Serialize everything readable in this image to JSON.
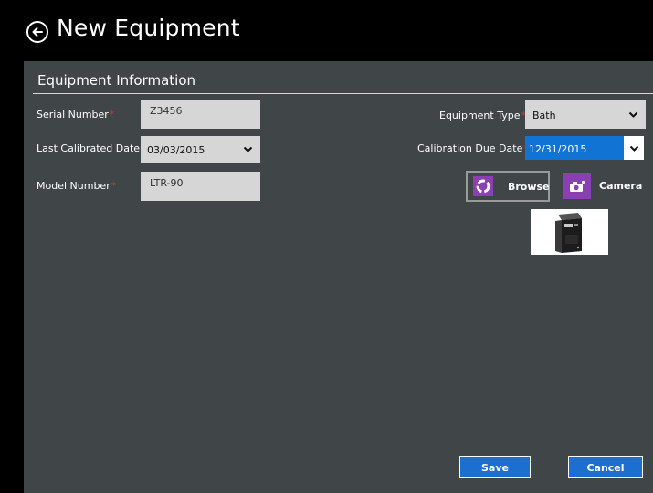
{
  "header": {
    "title": "New Equipment",
    "back_icon": "back-arrow-icon"
  },
  "section": {
    "title": "Equipment Information"
  },
  "fields": {
    "serial_number": {
      "label": "Serial Number",
      "required_mark": "*",
      "value": "Z3456"
    },
    "last_calibrated_date": {
      "label": "Last Calibrated Date",
      "required_mark": "*",
      "value": "03/03/2015"
    },
    "model_number": {
      "label": "Model Number",
      "required_mark": "*",
      "value": "LTR-90"
    },
    "equipment_type": {
      "label": "Equipment Type",
      "required_mark": "*",
      "value": "Bath"
    },
    "calibration_due_date": {
      "label": "Calibration Due Date",
      "required_mark": "*",
      "value": "12/31/2015"
    }
  },
  "media": {
    "browse_label": "Browse",
    "camera_label": "Camera"
  },
  "actions": {
    "save_label": "Save",
    "cancel_label": "Cancel"
  },
  "colors": {
    "accent": "#1a6fd0",
    "icon_bg": "#8a3fb3",
    "panel": "#404548",
    "required": "#e0303a"
  }
}
